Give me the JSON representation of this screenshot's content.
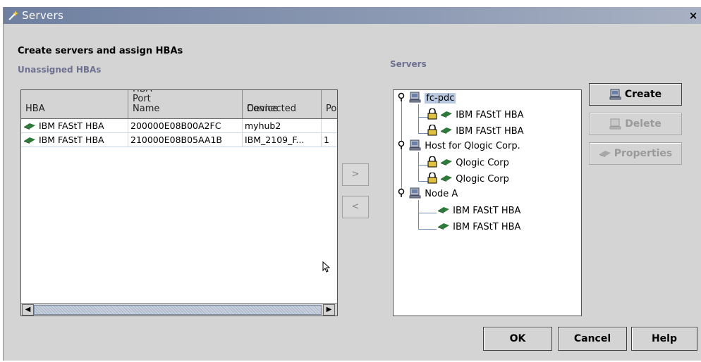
{
  "window": {
    "title": "Servers"
  },
  "heading": "Create servers and assign HBAs",
  "unassigned": {
    "label": "Unassigned HBAs",
    "columns": [
      {
        "line1": "",
        "line2": "HBA"
      },
      {
        "line1": "",
        "line2": "HBA Port Name"
      },
      {
        "line1": "Connected",
        "line2": "Device"
      },
      {
        "line1": "",
        "line2": "Po"
      }
    ],
    "rows": [
      {
        "hba": "IBM FAStT HBA",
        "port": "200000E08B00A2FC",
        "device": "myhub2",
        "po": ""
      },
      {
        "hba": "IBM FAStT HBA",
        "port": "210000E08B05AA1B",
        "device": "IBM_2109_F...",
        "po": "1"
      }
    ]
  },
  "move_buttons": {
    "assign": ">",
    "unassign": "<"
  },
  "servers": {
    "label": "Servers",
    "tree": [
      {
        "name": "fc-pdc",
        "selected": true,
        "children": [
          {
            "label": "IBM FAStT HBA",
            "locked": true
          },
          {
            "label": "IBM FAStT HBA",
            "locked": true
          }
        ]
      },
      {
        "name": "Host for Qlogic Corp.",
        "selected": false,
        "children": [
          {
            "label": "Qlogic Corp",
            "locked": true
          },
          {
            "label": "Qlogic Corp",
            "locked": true
          }
        ]
      },
      {
        "name": "Node A",
        "selected": false,
        "children": [
          {
            "label": "IBM FAStT HBA",
            "locked": false
          },
          {
            "label": "IBM FAStT HBA",
            "locked": false
          }
        ]
      }
    ]
  },
  "side_buttons": {
    "create": "Create",
    "delete": "Delete",
    "properties": "Properties"
  },
  "footer": {
    "ok": "OK",
    "cancel": "Cancel",
    "help": "Help"
  },
  "close_glyph": "×"
}
